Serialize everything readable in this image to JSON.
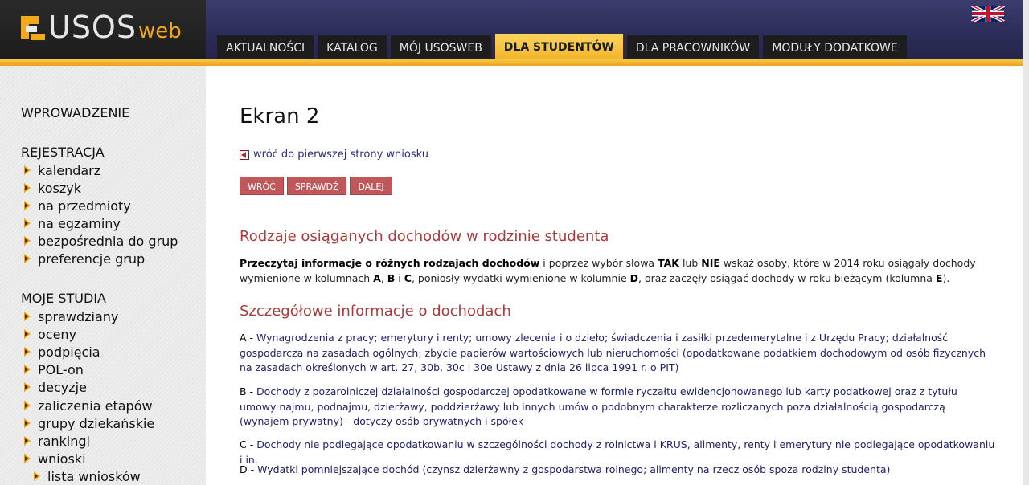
{
  "logo": {
    "usos": "USOS",
    "web": "web"
  },
  "nav": {
    "tabs": [
      {
        "label": "AKTUALNOŚCI"
      },
      {
        "label": "KATALOG"
      },
      {
        "label": "MÓJ USOSWEB"
      },
      {
        "label": "DLA STUDENTÓW"
      },
      {
        "label": "DLA PRACOWNIKÓW"
      },
      {
        "label": "MODUŁY DODATKOWE"
      }
    ]
  },
  "sidebar": {
    "intro": "WPROWADZENIE",
    "registration": {
      "title": "REJESTRACJA",
      "items": [
        "kalendarz",
        "koszyk",
        "na przedmioty",
        "na egzaminy",
        "bezpośrednia do grup",
        "preferencje grup"
      ]
    },
    "studies": {
      "title": "MOJE STUDIA",
      "items": [
        "sprawdziany",
        "oceny",
        "podpięcia",
        "POL-on",
        "decyzje",
        "zaliczenia etapów",
        "grupy dziekańskie",
        "rankingi",
        "wnioski"
      ],
      "sub": [
        "lista wniosków"
      ]
    }
  },
  "main": {
    "title": "Ekran 2",
    "back_link": "wróć do pierwszej strony wniosku",
    "buttons": {
      "back": "WRÓĆ",
      "check": "SPRAWDŹ",
      "next": "DALEJ"
    },
    "section1": "Rodzaje osiąganych dochodów w rodzinie studenta",
    "intro": {
      "p1": "Przeczytaj informacje o różnych rodzajach dochodów",
      "p2": " i poprzez wybór słowa ",
      "tak": "TAK",
      "p3": " lub ",
      "nie": "NIE",
      "p4": " wskaż osoby, które w 2014 roku osiągały dochody wymienione w kolumnach ",
      "a": "A",
      "comma": ", ",
      "b": "B",
      "i": " i ",
      "c": "C",
      "p5": ", poniosły wydatki wymienione w kolumnie ",
      "d": "D",
      "p6": ", oraz zaczęły osiągać dochody w roku bieżącym (kolumna ",
      "e": "E",
      "p7": ")."
    },
    "section2": "Szczegółowe informacje o dochodach",
    "details": [
      {
        "label": "A - ",
        "text": "Wynagrodzenia z pracy; emerytury i renty; umowy zlecenia i o dzieło; świadczenia i zasiłki przedemerytalne i z Urzędu Pracy; działalność gospodarcza na zasadach ogólnych; zbycie papierów wartościowych lub nieruchomości (opodatkowane podatkiem dochodowym od osób fizycznych na zasadach określonych w art. 27, 30b, 30c i 30e Ustawy z dnia 26 lipca 1991 r. o PIT)"
      },
      {
        "label": "B - ",
        "text": "Dochody z pozarolniczej działalności gospodarczej opodatkowane w formie ryczałtu ewidencjonowanego lub karty podatkowej oraz z tytułu umowy najmu, podnajmu, dzierżawy, poddzierżawy lub innych umów o podobnym charakterze rozliczanych poza działalnością gospodarczą (wynajem prywatny) - dotyczy osób prywatnych i spółek"
      },
      {
        "label": "C - ",
        "text": "Dochody nie podlegające opodatkowaniu w szczególności dochody z rolnictwa i KRUS, alimenty, renty i emerytury nie podlegające opodatkowaniu i in."
      },
      {
        "label": "D - ",
        "text": "Wydatki pomniejszające dochód (czynsz dzierżawny z gospodarstwa rolnego; alimenty na rzecz osób spoza rodziny studenta)"
      }
    ]
  },
  "colors": {
    "accent_gold": "#f2b52c",
    "header_navy": "#2a2a55",
    "section_red": "#a83b3b",
    "link_blue": "#2b2b7a",
    "button_red": "#c0575b"
  },
  "icons": {
    "logo": "usos-logo-icon",
    "flag": "uk-flag-icon",
    "bullet": "bullet-arrow-icon",
    "back": "back-arrow-icon"
  }
}
